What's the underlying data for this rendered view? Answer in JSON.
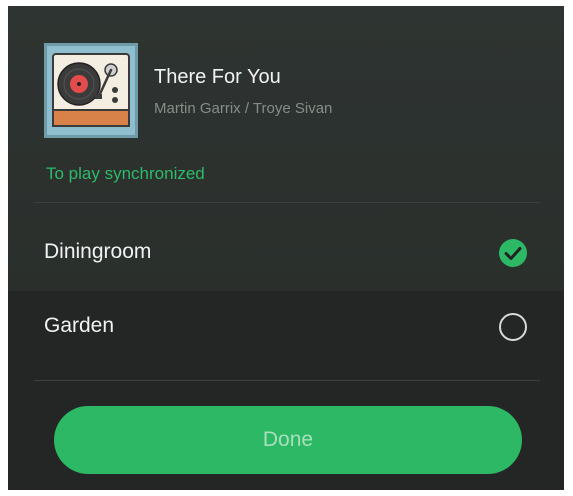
{
  "now_playing": {
    "title": "There For You",
    "artist": "Martin Garrix / Troye Sivan",
    "album_art_icon": "turntable-icon"
  },
  "sync_label": "To play synchronized",
  "devices": [
    {
      "label": "Diningroom",
      "selected": true,
      "icon": "checkmark-circle-icon"
    },
    {
      "label": "Garden",
      "selected": false,
      "icon": "empty-circle-icon"
    }
  ],
  "done_label": "Done",
  "colors": {
    "accent": "#2db865",
    "background": "#2b302d",
    "text_primary": "#f2f2f2",
    "text_secondary": "#868c88"
  }
}
